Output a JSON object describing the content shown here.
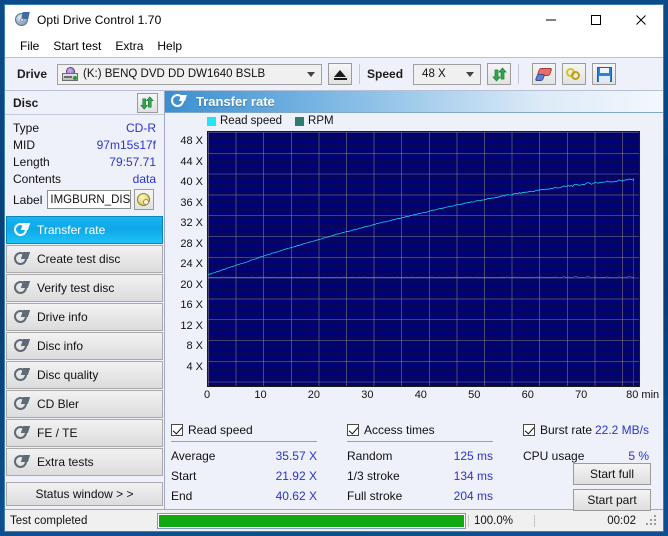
{
  "window": {
    "title": "Opti Drive Control 1.70",
    "icon": "optical-disc-icon",
    "minimize": "minimize-icon",
    "maximize": "maximize-icon",
    "close": "close-icon"
  },
  "menu": {
    "items": [
      "File",
      "Start test",
      "Extra",
      "Help"
    ]
  },
  "toolbar": {
    "drive_label": "Drive",
    "drive_value": "(K:)  BENQ DVD DD DW1640 BSLB",
    "eject_icon": "eject-icon",
    "speed_label": "Speed",
    "speed_value": "48 X",
    "refresh_icon": "refresh-icon",
    "erase_icon": "eraser-icon",
    "chain_icon": "chain-icon",
    "save_icon": "save-icon"
  },
  "disc": {
    "header": "Disc",
    "refresh_icon": "refresh-icon",
    "rows": [
      {
        "key": "Type",
        "value": "CD-R"
      },
      {
        "key": "MID",
        "value": "97m15s17f"
      },
      {
        "key": "Length",
        "value": "79:57.71"
      },
      {
        "key": "Contents",
        "value": "data"
      }
    ],
    "label_key": "Label",
    "label_value": "IMGBURN_DIS",
    "label_button_icon": "cd-disc-icon"
  },
  "nav": {
    "items": [
      {
        "label": "Transfer rate",
        "icon": "disc-test-icon",
        "active": true
      },
      {
        "label": "Create test disc",
        "icon": "disc-test-icon",
        "active": false
      },
      {
        "label": "Verify test disc",
        "icon": "disc-test-icon",
        "active": false
      },
      {
        "label": "Drive info",
        "icon": "disc-test-icon",
        "active": false
      },
      {
        "label": "Disc info",
        "icon": "disc-test-icon",
        "active": false
      },
      {
        "label": "Disc quality",
        "icon": "disc-test-icon",
        "active": false
      },
      {
        "label": "CD Bler",
        "icon": "disc-test-icon",
        "active": false
      },
      {
        "label": "FE / TE",
        "icon": "disc-test-icon",
        "active": false
      },
      {
        "label": "Extra tests",
        "icon": "disc-test-icon",
        "active": false
      }
    ],
    "status_window": "Status window > >"
  },
  "panel": {
    "title": "Transfer rate",
    "icon": "disc-test-icon"
  },
  "chart_data": {
    "type": "line",
    "title": "Transfer rate",
    "xlabel": "80 min",
    "ylabel": "",
    "xlim": [
      0,
      81
    ],
    "ylim": [
      0,
      50
    ],
    "grid": true,
    "legend_position": "top-left",
    "background": "#00006b",
    "xticks": [
      0,
      10,
      20,
      30,
      40,
      50,
      60,
      70
    ],
    "xtick_labels": [
      "0",
      "10",
      "20",
      "30",
      "40",
      "50",
      "60",
      "70"
    ],
    "x_axis_end_label": "80 min",
    "yticks": [
      4,
      8,
      12,
      16,
      20,
      24,
      28,
      32,
      36,
      40,
      44,
      48
    ],
    "ytick_labels": [
      "4 X",
      "8 X",
      "12 X",
      "16 X",
      "20 X",
      "24 X",
      "28 X",
      "32 X",
      "36 X",
      "40 X",
      "44 X",
      "48 X"
    ],
    "series": [
      {
        "name": "Read speed",
        "color": "#24e3f5",
        "x": [
          0,
          2,
          4,
          6,
          8,
          10,
          12,
          14,
          16,
          18,
          20,
          22,
          24,
          26,
          28,
          30,
          32,
          34,
          36,
          38,
          40,
          42,
          44,
          46,
          48,
          50,
          52,
          54,
          56,
          58,
          60,
          62,
          64,
          66,
          68,
          70,
          72,
          74,
          76,
          78,
          80
        ],
        "values": [
          21.92,
          22.6,
          23.3,
          24.0,
          24.7,
          25.4,
          26.1,
          26.75,
          27.4,
          28.0,
          28.6,
          29.2,
          29.8,
          30.35,
          30.9,
          31.45,
          32.0,
          32.5,
          33.0,
          33.5,
          34.0,
          34.5,
          35.0,
          35.45,
          35.9,
          36.3,
          36.7,
          37.1,
          37.5,
          37.85,
          38.2,
          38.5,
          38.8,
          39.1,
          39.4,
          39.65,
          39.9,
          40.1,
          40.3,
          40.5,
          40.62
        ]
      },
      {
        "name": "RPM",
        "color": "#9aa8c8",
        "x": [
          0,
          10,
          20,
          30,
          40,
          50,
          60,
          70,
          80
        ],
        "values": [
          21.4,
          21.4,
          21.4,
          21.4,
          21.4,
          21.4,
          21.4,
          21.4,
          21.4
        ]
      }
    ],
    "legend": [
      {
        "label": "Read speed",
        "color": "#24e3f5"
      },
      {
        "label": "RPM",
        "color": "#2f7a72"
      }
    ]
  },
  "stats": {
    "read_speed": {
      "title": "Read speed",
      "checked": true,
      "rows": [
        {
          "key": "Average",
          "value": "35.57 X"
        },
        {
          "key": "Start",
          "value": "21.92 X"
        },
        {
          "key": "End",
          "value": "40.62 X"
        }
      ]
    },
    "access_times": {
      "title": "Access times",
      "checked": true,
      "rows": [
        {
          "key": "Random",
          "value": "125 ms"
        },
        {
          "key": "1/3 stroke",
          "value": "134 ms"
        },
        {
          "key": "Full stroke",
          "value": "204 ms"
        }
      ]
    },
    "burst": {
      "title": "Burst rate",
      "checked": true,
      "value": "22.2 MB/s",
      "cpu_key": "CPU usage",
      "cpu_value": "5 %"
    },
    "buttons": {
      "start_full": "Start full",
      "start_part": "Start part"
    }
  },
  "statusbar": {
    "message": "Test completed",
    "progress_percent": 100,
    "percent_label": "100.0%",
    "elapsed": "00:02"
  }
}
